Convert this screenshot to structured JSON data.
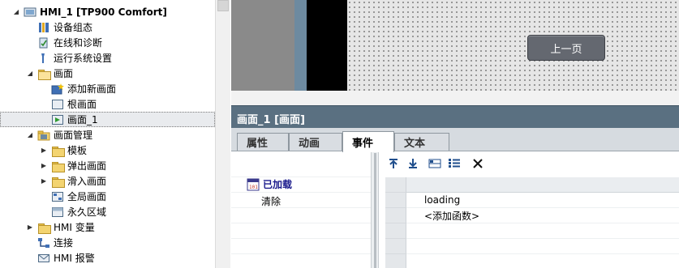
{
  "tree": {
    "device": "HMI_1 [TP900 Comfort]",
    "items": [
      {
        "label": "设备组态"
      },
      {
        "label": "在线和诊断"
      },
      {
        "label": "运行系统设置"
      },
      {
        "label": "画面"
      },
      {
        "label": "添加新画面"
      },
      {
        "label": "根画面"
      },
      {
        "label": "画面_1"
      },
      {
        "label": "画面管理"
      },
      {
        "label": "模板"
      },
      {
        "label": "弹出画面"
      },
      {
        "label": "滑入画面"
      },
      {
        "label": "全局画面"
      },
      {
        "label": "永久区域"
      },
      {
        "label": "HMI 变量"
      },
      {
        "label": "连接"
      },
      {
        "label": "HMI 报警"
      }
    ]
  },
  "preview": {
    "button_label": "上一页",
    "button_color": "#646870"
  },
  "panel": {
    "title": "画面_1 [画面]",
    "tabs": [
      {
        "label": "属性"
      },
      {
        "label": "动画"
      },
      {
        "label": "事件"
      },
      {
        "label": "文本"
      }
    ],
    "active_tab": "事件",
    "events": {
      "loaded": "已加载",
      "cleared": "清除"
    },
    "functions": [
      {
        "value": "loading"
      },
      {
        "value": "<添加函数>"
      }
    ]
  },
  "colors": {
    "title_bar": "#5a7081",
    "event_selected": "#1a1a8c"
  }
}
